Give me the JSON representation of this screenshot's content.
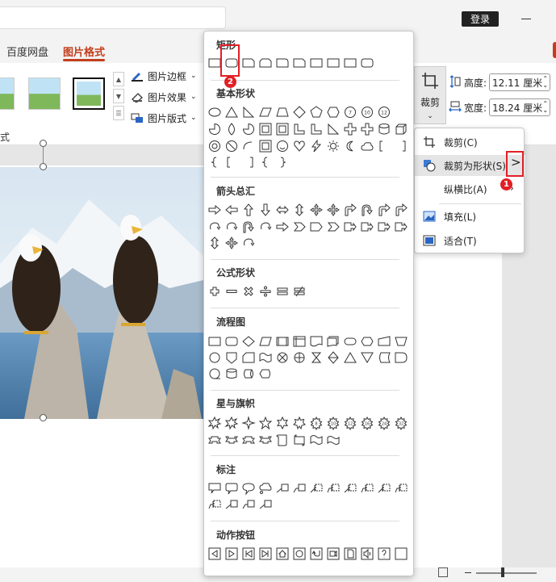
{
  "app": {
    "login_label": "登录"
  },
  "tabs": [
    {
      "label": "百度网盘"
    },
    {
      "label": "图片格式"
    }
  ],
  "ribbon": {
    "picture_border": "图片边框",
    "picture_effects": "图片效果",
    "picture_layout": "图片版式",
    "group_label_partial": "式",
    "crop_label": "裁剪",
    "height_label": "高度:",
    "height_value": "12.11 厘米",
    "width_label": "宽度:",
    "width_value": "18.24 厘米"
  },
  "crop_menu": {
    "items": [
      {
        "label": "裁剪(C)",
        "icon": "crop-icon"
      },
      {
        "label": "裁剪为形状(S)",
        "icon": "crop-shape-icon"
      },
      {
        "label": "纵横比(A)",
        "icon": ""
      },
      {
        "label": "填充(L)",
        "icon": "fill-icon"
      },
      {
        "label": "适合(T)",
        "icon": "fit-icon"
      }
    ],
    "submenu_arrow": ">"
  },
  "shape_panel": {
    "sections": [
      {
        "title": "矩形"
      },
      {
        "title": "基本形状"
      },
      {
        "title": "箭头总汇"
      },
      {
        "title": "公式形状"
      },
      {
        "title": "流程图"
      },
      {
        "title": "星与旗帜"
      },
      {
        "title": "标注"
      },
      {
        "title": "动作按钮"
      }
    ],
    "basic_numbers": [
      "7",
      "10",
      "12"
    ],
    "star_numbers": [
      "8",
      "10",
      "12",
      "16",
      "24",
      "32"
    ]
  },
  "annotations": {
    "badge_1": "1",
    "badge_2": "2"
  },
  "colors": {
    "accent": "#c43e1c",
    "annotation_red": "#e21f26"
  }
}
